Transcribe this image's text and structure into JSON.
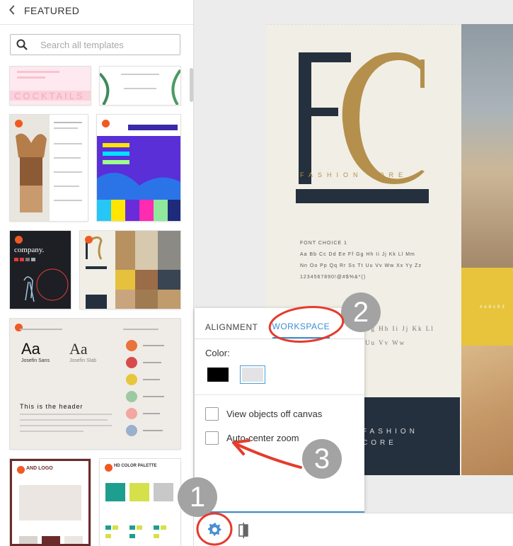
{
  "sidebar": {
    "back_label": "FEATURED",
    "search": {
      "placeholder": "Search all templates"
    },
    "templates": [
      {
        "name": "cocktails"
      },
      {
        "name": "botanical"
      },
      {
        "name": "coffee-splash"
      },
      {
        "name": "trunorth"
      },
      {
        "name": "company"
      },
      {
        "name": "fashion-core"
      },
      {
        "name": "typography"
      },
      {
        "name": "brand-logo"
      },
      {
        "name": "hd-color-palette"
      }
    ],
    "typography_card": {
      "aa1": "Aa",
      "aa1_font": "Josefin Sans",
      "aa2": "Aa",
      "aa2_font": "Josefin Slab",
      "header": "This is the header"
    },
    "brand_card": {
      "title": "AND LOGO"
    },
    "palette_card": {
      "title": "HD COLOR PALETTE"
    }
  },
  "canvas": {
    "fc_letters": "FC",
    "brand_name": "FASHION CORE",
    "font_choice": "FONT CHOICE 1",
    "alphabet1": "Aa Bb Cc Dd Ee Ff Gg Hh Ii Jj Kk Ll Mm",
    "alphabet2": "Nn Oo Pp Qq Rr Ss Tt Uu Vv Ww Xx Yy Zz",
    "digits": "1234567890!@#$%&*()",
    "hex": "#e8c93",
    "block_line1": "FASHION",
    "block_line2": "CORE",
    "faint_line1": "Gg Hh Ii Jj Kk Ll",
    "faint_line2": "Uu Vv Ww"
  },
  "panel": {
    "tabs": [
      {
        "label": "ALIGNMENT",
        "active": false
      },
      {
        "label": "WORKSPACE",
        "active": true
      }
    ],
    "color_label": "Color:",
    "swatches": [
      {
        "color": "#000000"
      },
      {
        "color": "#e3e3e6",
        "selected": true
      }
    ],
    "options": [
      {
        "label": "View objects off canvas",
        "checked": false
      },
      {
        "label": "Auto-center zoom",
        "checked": false
      }
    ]
  },
  "annotations": {
    "badges": [
      "1",
      "2",
      "3"
    ],
    "accent": "#e53b2c"
  },
  "bottombar": {
    "icons": [
      "gear-icon",
      "split-view-icon"
    ]
  }
}
